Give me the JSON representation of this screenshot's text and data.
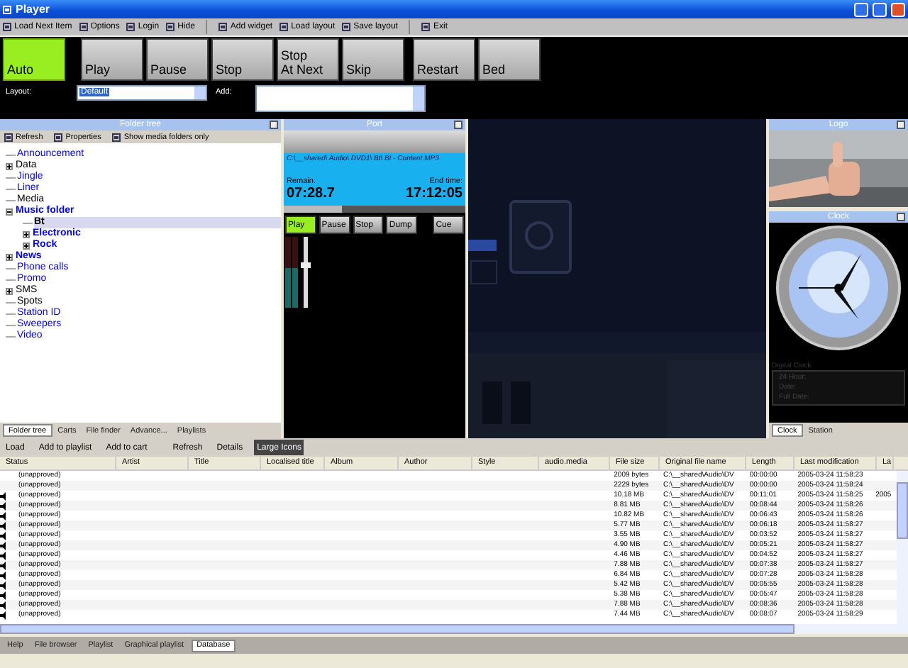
{
  "window": {
    "title": "Player"
  },
  "toolbar": [
    {
      "label": "Load Next Item"
    },
    {
      "label": "Options"
    },
    {
      "label": "Login"
    },
    {
      "label": "Hide"
    },
    {
      "label": "Add widget"
    },
    {
      "label": "Load layout"
    },
    {
      "label": "Save layout"
    },
    {
      "label": "Exit"
    }
  ],
  "transport": [
    {
      "label": "Auto",
      "selected": true
    },
    {
      "label": "Play",
      "selected": false
    },
    {
      "label": "Pause",
      "selected": false
    },
    {
      "label": "Stop",
      "selected": false
    },
    {
      "label": "Stop\nAt Next",
      "selected": false
    },
    {
      "label": "Skip",
      "selected": false
    },
    {
      "label": "Restart",
      "selected": false
    },
    {
      "label": "Bed",
      "selected": false
    }
  ],
  "layout_select": {
    "label": "Layout:",
    "value": "Default"
  },
  "add_select": {
    "label": "Add:"
  },
  "folder_tree": {
    "title": "Folder tree",
    "toolbar": [
      "Refresh",
      "Properties",
      "Show media folders only"
    ],
    "items": [
      {
        "label": "Announcement",
        "color": "#0000ff",
        "bold": false,
        "selected": false
      },
      {
        "label": "Data",
        "color": "#000000",
        "bold": false,
        "selected": false,
        "expanded": false
      },
      {
        "label": "Jingle",
        "color": "#0000ff",
        "bold": false,
        "selected": false
      },
      {
        "label": "Liner",
        "color": "#0000ff",
        "bold": false,
        "selected": false
      },
      {
        "label": "Media",
        "color": "#000000",
        "bold": false,
        "selected": false
      },
      {
        "label": "Music folder",
        "color": "#0000ff",
        "bold": true,
        "selected": false,
        "expanded": true,
        "children": [
          {
            "label": "Bt",
            "color": "#000000",
            "bold": true,
            "selected": true
          },
          {
            "label": "Electronic",
            "color": "#0000ff",
            "bold": true,
            "selected": false,
            "expanded": false
          },
          {
            "label": "Rock",
            "color": "#0000ff",
            "bold": true,
            "selected": false,
            "expanded": false
          }
        ]
      },
      {
        "label": "News",
        "color": "#0000ff",
        "bold": true,
        "selected": false,
        "expanded": false
      },
      {
        "label": "Phone calls",
        "color": "#0000ff",
        "bold": false,
        "selected": false
      },
      {
        "label": "Promo",
        "color": "#0000ff",
        "bold": false,
        "selected": false
      },
      {
        "label": "SMS",
        "color": "#000000",
        "bold": false,
        "selected": false,
        "expanded": false
      },
      {
        "label": "Spots",
        "color": "#000000",
        "bold": false,
        "selected": false
      },
      {
        "label": "Station ID",
        "color": "#0000ff",
        "bold": false,
        "selected": false
      },
      {
        "label": "Sweepers",
        "color": "#0000ff",
        "bold": false,
        "selected": false
      },
      {
        "label": "Video",
        "color": "#0000ff",
        "bold": false,
        "selected": false
      }
    ],
    "tabs": [
      {
        "label": "Folder tree",
        "selected": true
      },
      {
        "label": "Carts",
        "selected": false
      },
      {
        "label": "File finder",
        "selected": false
      },
      {
        "label": "Advance...",
        "selected": false
      },
      {
        "label": "Playlists",
        "selected": false
      }
    ]
  },
  "port": {
    "title": "Port",
    "path": "C:\\__shared\\ Audio\\ DVD1\\ Bt\\ Bt - Content.MP3",
    "remain_label": "Remain.",
    "remain": "07:28.7",
    "end_label": "End time:",
    "end_time": "17:12:05",
    "level": 0.32,
    "buttons": [
      {
        "label": "Play",
        "selected": true
      },
      {
        "label": "Pause",
        "selected": false
      },
      {
        "label": "Stop",
        "selected": false
      },
      {
        "label": "Dump",
        "selected": false
      },
      {
        "label": "Cue",
        "selected": false
      }
    ]
  },
  "logo": {
    "title": "Logo"
  },
  "clock": {
    "title": "Clock",
    "digital_title": "Digital Clock",
    "labels": [
      "24 Hour:",
      "Date:",
      "Full Date:"
    ],
    "tabs": [
      {
        "label": "Clock",
        "selected": true
      },
      {
        "label": "Station",
        "selected": false
      }
    ]
  },
  "library": {
    "toolbar": [
      {
        "label": "Load",
        "selected": false
      },
      {
        "label": "Add to playlist",
        "selected": false
      },
      {
        "label": "Add to cart",
        "selected": false
      },
      {
        "label": "Refresh",
        "selected": false
      },
      {
        "label": "Details",
        "selected": false
      },
      {
        "label": "Large Icons",
        "selected": true
      }
    ],
    "columns": [
      "Status",
      "Artist",
      "Title",
      "Localised title",
      "Album",
      "Author",
      "Style",
      "audio.media",
      "File size",
      "Original file name",
      "Length",
      "Last modification",
      "La"
    ],
    "rows": [
      {
        "audio": false,
        "status": "(unapproved)",
        "size": "2009 bytes",
        "file": "C:\\__shared\\Audio\\DV",
        "length": "00:00:00",
        "modified": "2005-03-24 11:58:23"
      },
      {
        "audio": false,
        "status": "(unapproved)",
        "size": "2229 bytes",
        "file": "C:\\__shared\\Audio\\DV",
        "length": "00:00:00",
        "modified": "2005-03-24 11:58:24"
      },
      {
        "audio": true,
        "status": "(unapproved)",
        "size": "10.18 MB",
        "file": "C:\\__shared\\Audio\\DV",
        "length": "00:11:01",
        "modified": "2005-03-24 11:58:25",
        "last": "2005"
      },
      {
        "audio": true,
        "status": "(unapproved)",
        "size": "8.81 MB",
        "file": "C:\\__shared\\Audio\\DV",
        "length": "00:08:44",
        "modified": "2005-03-24 11:58:26"
      },
      {
        "audio": true,
        "status": "(unapproved)",
        "size": "10.82 MB",
        "file": "C:\\__shared\\Audio\\DV",
        "length": "00:06:43",
        "modified": "2005-03-24 11:58:26"
      },
      {
        "audio": true,
        "status": "(unapproved)",
        "size": "5.77 MB",
        "file": "C:\\__shared\\Audio\\DV",
        "length": "00:06:18",
        "modified": "2005-03-24 11:58:27"
      },
      {
        "audio": true,
        "status": "(unapproved)",
        "size": "3.55 MB",
        "file": "C:\\__shared\\Audio\\DV",
        "length": "00:03:52",
        "modified": "2005-03-24 11:58:27"
      },
      {
        "audio": true,
        "status": "(unapproved)",
        "size": "4.90 MB",
        "file": "C:\\__shared\\Audio\\DV",
        "length": "00:05:21",
        "modified": "2005-03-24 11:58:27"
      },
      {
        "audio": true,
        "status": "(unapproved)",
        "size": "4.46 MB",
        "file": "C:\\__shared\\Audio\\DV",
        "length": "00:04:52",
        "modified": "2005-03-24 11:58:27"
      },
      {
        "audio": true,
        "status": "(unapproved)",
        "size": "7.88 MB",
        "file": "C:\\__shared\\Audio\\DV",
        "length": "00:07:38",
        "modified": "2005-03-24 11:58:27"
      },
      {
        "audio": true,
        "status": "(unapproved)",
        "size": "6.84 MB",
        "file": "C:\\__shared\\Audio\\DV",
        "length": "00:07:28",
        "modified": "2005-03-24 11:58:28"
      },
      {
        "audio": true,
        "status": "(unapproved)",
        "size": "5.42 MB",
        "file": "C:\\__shared\\Audio\\DV",
        "length": "00:05:55",
        "modified": "2005-03-24 11:58:28"
      },
      {
        "audio": true,
        "status": "(unapproved)",
        "size": "5.38 MB",
        "file": "C:\\__shared\\Audio\\DV",
        "length": "00:05:47",
        "modified": "2005-03-24 11:58:28"
      },
      {
        "audio": true,
        "status": "(unapproved)",
        "size": "7.88 MB",
        "file": "C:\\__shared\\Audio\\DV",
        "length": "00:08:36",
        "modified": "2005-03-24 11:58:28"
      },
      {
        "audio": true,
        "status": "(unapproved)",
        "size": "7.44 MB",
        "file": "C:\\__shared\\Audio\\DV",
        "length": "00:08:07",
        "modified": "2005-03-24 11:58:29"
      }
    ]
  },
  "bottom_tabs": [
    {
      "label": "Help",
      "selected": false
    },
    {
      "label": "File browser",
      "selected": false
    },
    {
      "label": "Playlist",
      "selected": false
    },
    {
      "label": "Graphical playlist",
      "selected": false
    },
    {
      "label": "Database",
      "selected": true
    }
  ]
}
